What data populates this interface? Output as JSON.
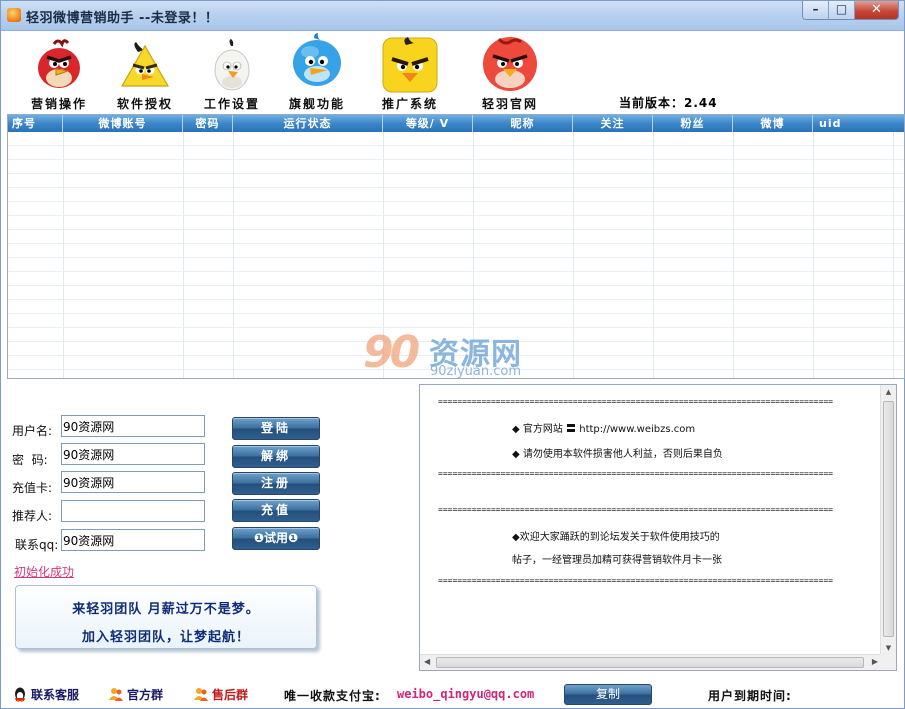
{
  "window": {
    "title": "轻羽微博营销助手 --未登录！！",
    "minimize_glyph": "–",
    "maximize_glyph": "□",
    "close_glyph": "✕"
  },
  "toolbar": {
    "items": [
      {
        "label": "营销操作",
        "icon": "red-bird-icon"
      },
      {
        "label": "软件授权",
        "icon": "yellow-bird-icon"
      },
      {
        "label": "工作设置",
        "icon": "white-bird-icon"
      },
      {
        "label": "旗舰功能",
        "icon": "blue-bird-icon"
      },
      {
        "label": "推广系统",
        "icon": "yellow-square-bird-icon"
      },
      {
        "label": "轻羽官网",
        "icon": "red-round-bird-icon"
      }
    ],
    "version_label": "当前版本：2.44"
  },
  "table": {
    "columns": [
      "序号",
      "微博账号",
      "密码",
      "运行状态",
      "等级/ V",
      "昵称",
      "关注",
      "粉丝",
      "微博",
      "uid"
    ],
    "rows": []
  },
  "watermark": {
    "number": "90",
    "text": "资源网",
    "domain": "90ziyuan.com"
  },
  "form": {
    "username_label": "用户名:",
    "username_value": "90资源网",
    "password_label": "密  码:",
    "password_value": "90资源网",
    "card_label": "充值卡:",
    "card_value": "90资源网",
    "referrer_label": "推荐人:",
    "referrer_value": "",
    "qq_label": "联系qq:",
    "qq_value": "90资源网",
    "login_button": "登陆",
    "unbind_button": "解绑",
    "register_button": "注册",
    "recharge_button": "充值",
    "trial_button": "❶试用❶",
    "init_status": "初始化成功"
  },
  "promo": {
    "line1": "来轻羽团队  月薪过万不是梦。",
    "line2": "加入轻羽团队，让梦起航！"
  },
  "notice": {
    "separator": "==================================================================================",
    "lines": [
      "◆  官方网站  〓  http://www.weibzs.com",
      "◆  请勿使用本软件损害他人利益，否则后果自负",
      "◆欢迎大家踊跃的到论坛发关于软件使用技巧的",
      "帖子，一经管理员加精可获得营销软件月卡一张"
    ]
  },
  "bottom": {
    "support": "联系客服",
    "official_group": "官方群",
    "aftersale": "售后群",
    "pay_label": "唯一收款支付宝:",
    "pay_email": "weibo_qingyu@qq.com",
    "copy_button": "复制",
    "expire_label": "用户到期时间:"
  },
  "colors": {
    "header_blue": "#3c86c9",
    "button_blue": "#2d5f90",
    "link_pink": "#d23a7e",
    "promo_text": "#0f2d77"
  }
}
